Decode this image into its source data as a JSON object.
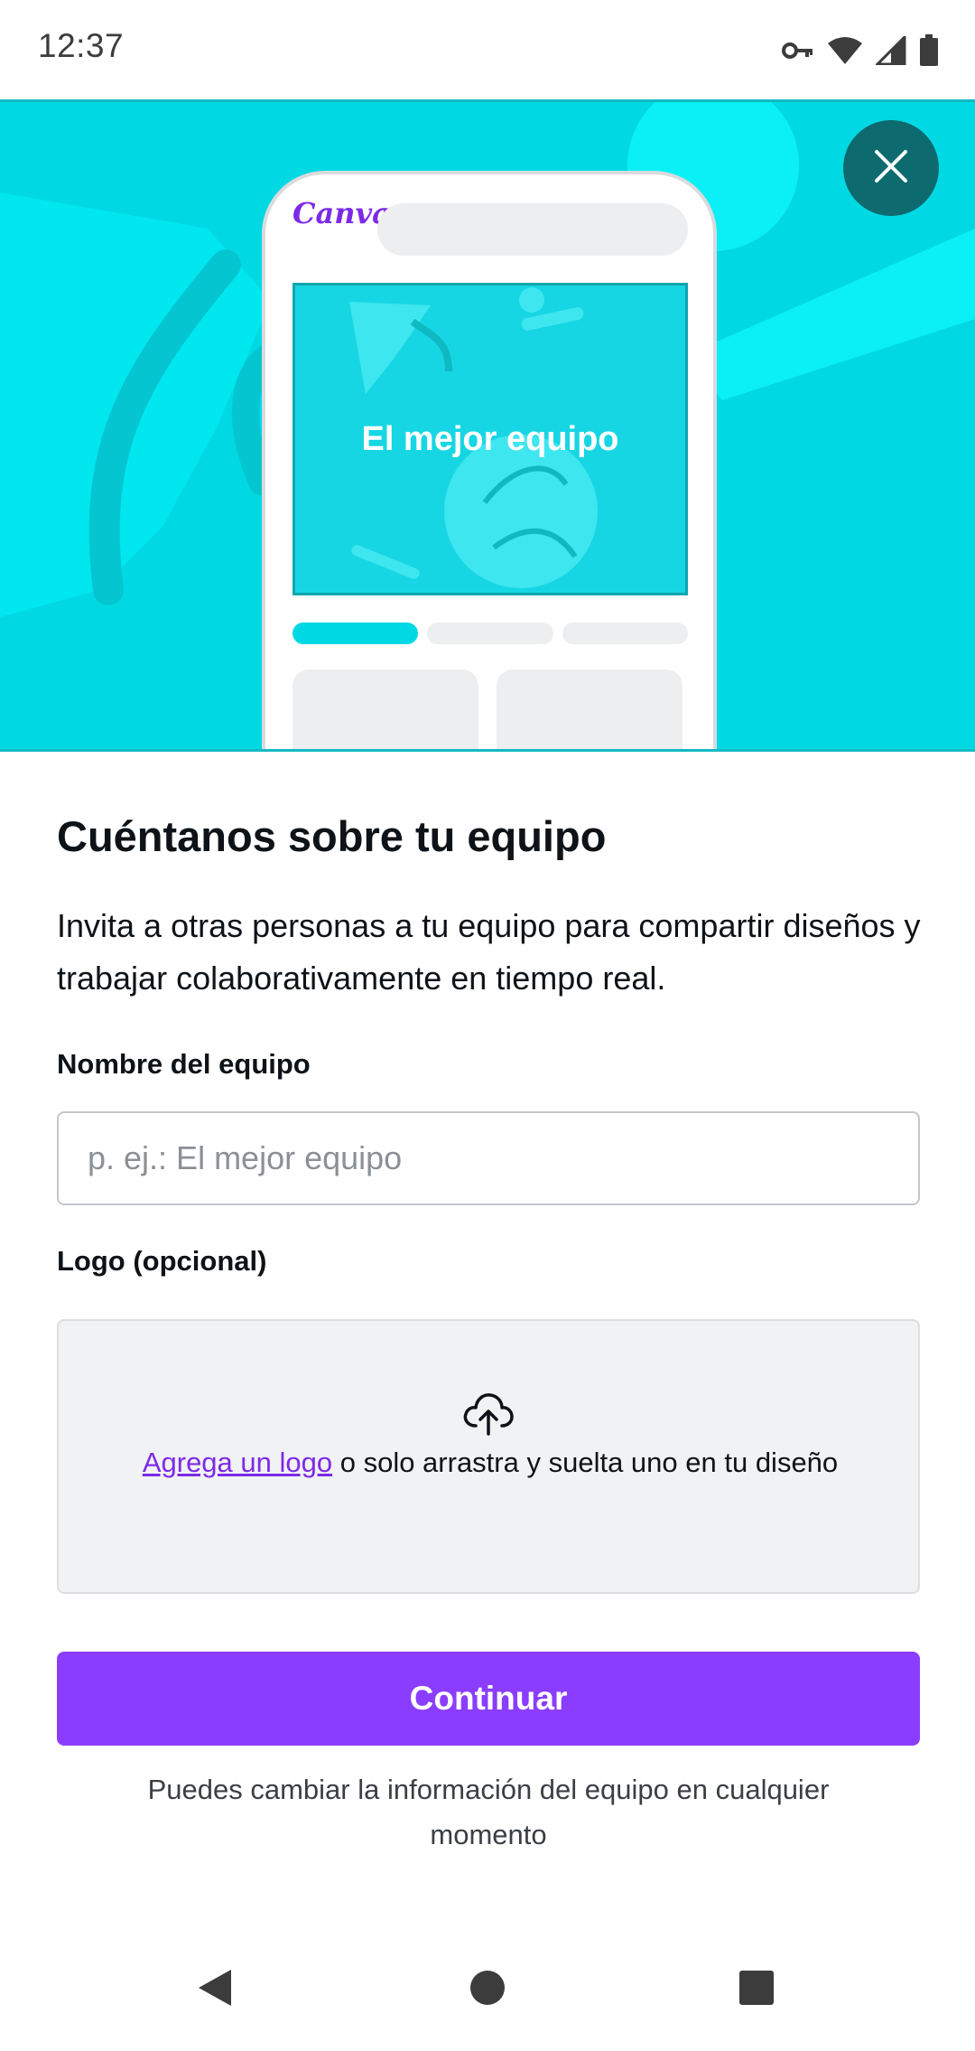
{
  "status_bar": {
    "time": "12:37",
    "icons": [
      "vpn-key-icon",
      "wifi-icon",
      "cell-signal-icon",
      "battery-icon"
    ]
  },
  "hero": {
    "close_icon": "close-icon",
    "phone_preview": {
      "brand": "Canva",
      "canvas_text": "El mejor equipo"
    }
  },
  "form": {
    "title": "Cuéntanos sobre tu equipo",
    "description": "Invita a otras personas a tu equipo para compartir diseños y trabajar colaborativamente en tiempo real.",
    "team_name": {
      "label": "Nombre del equipo",
      "value": "",
      "placeholder": "p. ej.: El mejor equipo"
    },
    "logo": {
      "label": "Logo (opcional)",
      "icon": "cloud-upload-icon",
      "link_text": "Agrega un logo",
      "rest_text": " o solo arrastra y suelta uno en tu diseño"
    },
    "continue_label": "Continuar",
    "footnote": "Puedes cambiar la información del equipo en cualquier momento"
  },
  "nav_bar": {
    "icons": [
      "back-icon",
      "home-icon",
      "recents-icon"
    ]
  },
  "colors": {
    "hero_background": "#00d9e3",
    "close_button": "#0d6a6e",
    "primary_button": "#8b3dff",
    "link": "#7d2ae8"
  }
}
